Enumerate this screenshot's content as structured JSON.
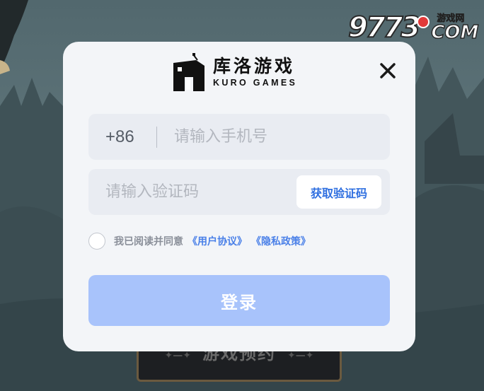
{
  "background": {
    "reserve_button_label": "游戏预约",
    "reserve_button_deco": "✦—✦",
    "watermark": {
      "number": "9773",
      "site_cn": "游戏网",
      "site_en": "COM"
    }
  },
  "modal": {
    "logo": {
      "name_cn": "库洛游戏",
      "name_en": "KURO GAMES"
    },
    "close_icon": "close-icon",
    "phone": {
      "prefix": "+86",
      "placeholder": "请输入手机号",
      "value": ""
    },
    "code": {
      "placeholder": "请输入验证码",
      "value": "",
      "get_code_label": "获取验证码"
    },
    "agreement": {
      "text": "我已阅读并同意",
      "user_agreement": "《用户协议》",
      "privacy_policy": "《隐私政策》",
      "checked": false
    },
    "login_label": "登录"
  },
  "colors": {
    "accent": "#2f6fe0",
    "link": "#4a80e8",
    "login_button": "#a8c3fb",
    "modal_bg": "#f3f5f8",
    "field_bg": "#e9ecf2"
  }
}
